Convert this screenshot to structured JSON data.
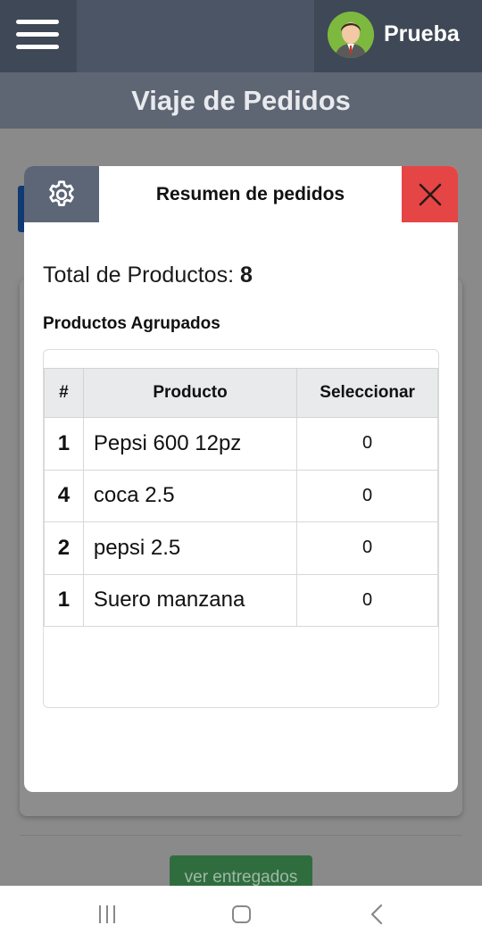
{
  "app": {
    "user_name": "Prueba",
    "page_title": "Viaje de Pedidos"
  },
  "background": {
    "button_label": "ver entregados"
  },
  "modal": {
    "title": "Resumen de pedidos",
    "total_label": "Total de Productos:",
    "total_value": "8",
    "grouped_title": "Productos Agrupados",
    "table": {
      "headers": [
        "#",
        "Producto",
        "Seleccionar"
      ],
      "rows": [
        {
          "qty": "1",
          "product": "Pepsi 600 12pz",
          "select": "0"
        },
        {
          "qty": "4",
          "product": "coca 2.5",
          "select": "0"
        },
        {
          "qty": "2",
          "product": "pepsi 2.5",
          "select": "0"
        },
        {
          "qty": "1",
          "product": "Suero manzana",
          "select": "0"
        }
      ]
    }
  },
  "icons": {
    "menu": "hamburger-menu-icon",
    "settings": "gear-icon",
    "close": "close-icon",
    "nav_recents": "recents-icon",
    "nav_home": "home-icon",
    "nav_back": "back-chevron-icon"
  },
  "colors": {
    "topbar": "#3f4856",
    "header": "#5e6673",
    "settings_bg": "#5c6677",
    "close_bg": "#e64545",
    "green_button": "#2f6d3e"
  }
}
